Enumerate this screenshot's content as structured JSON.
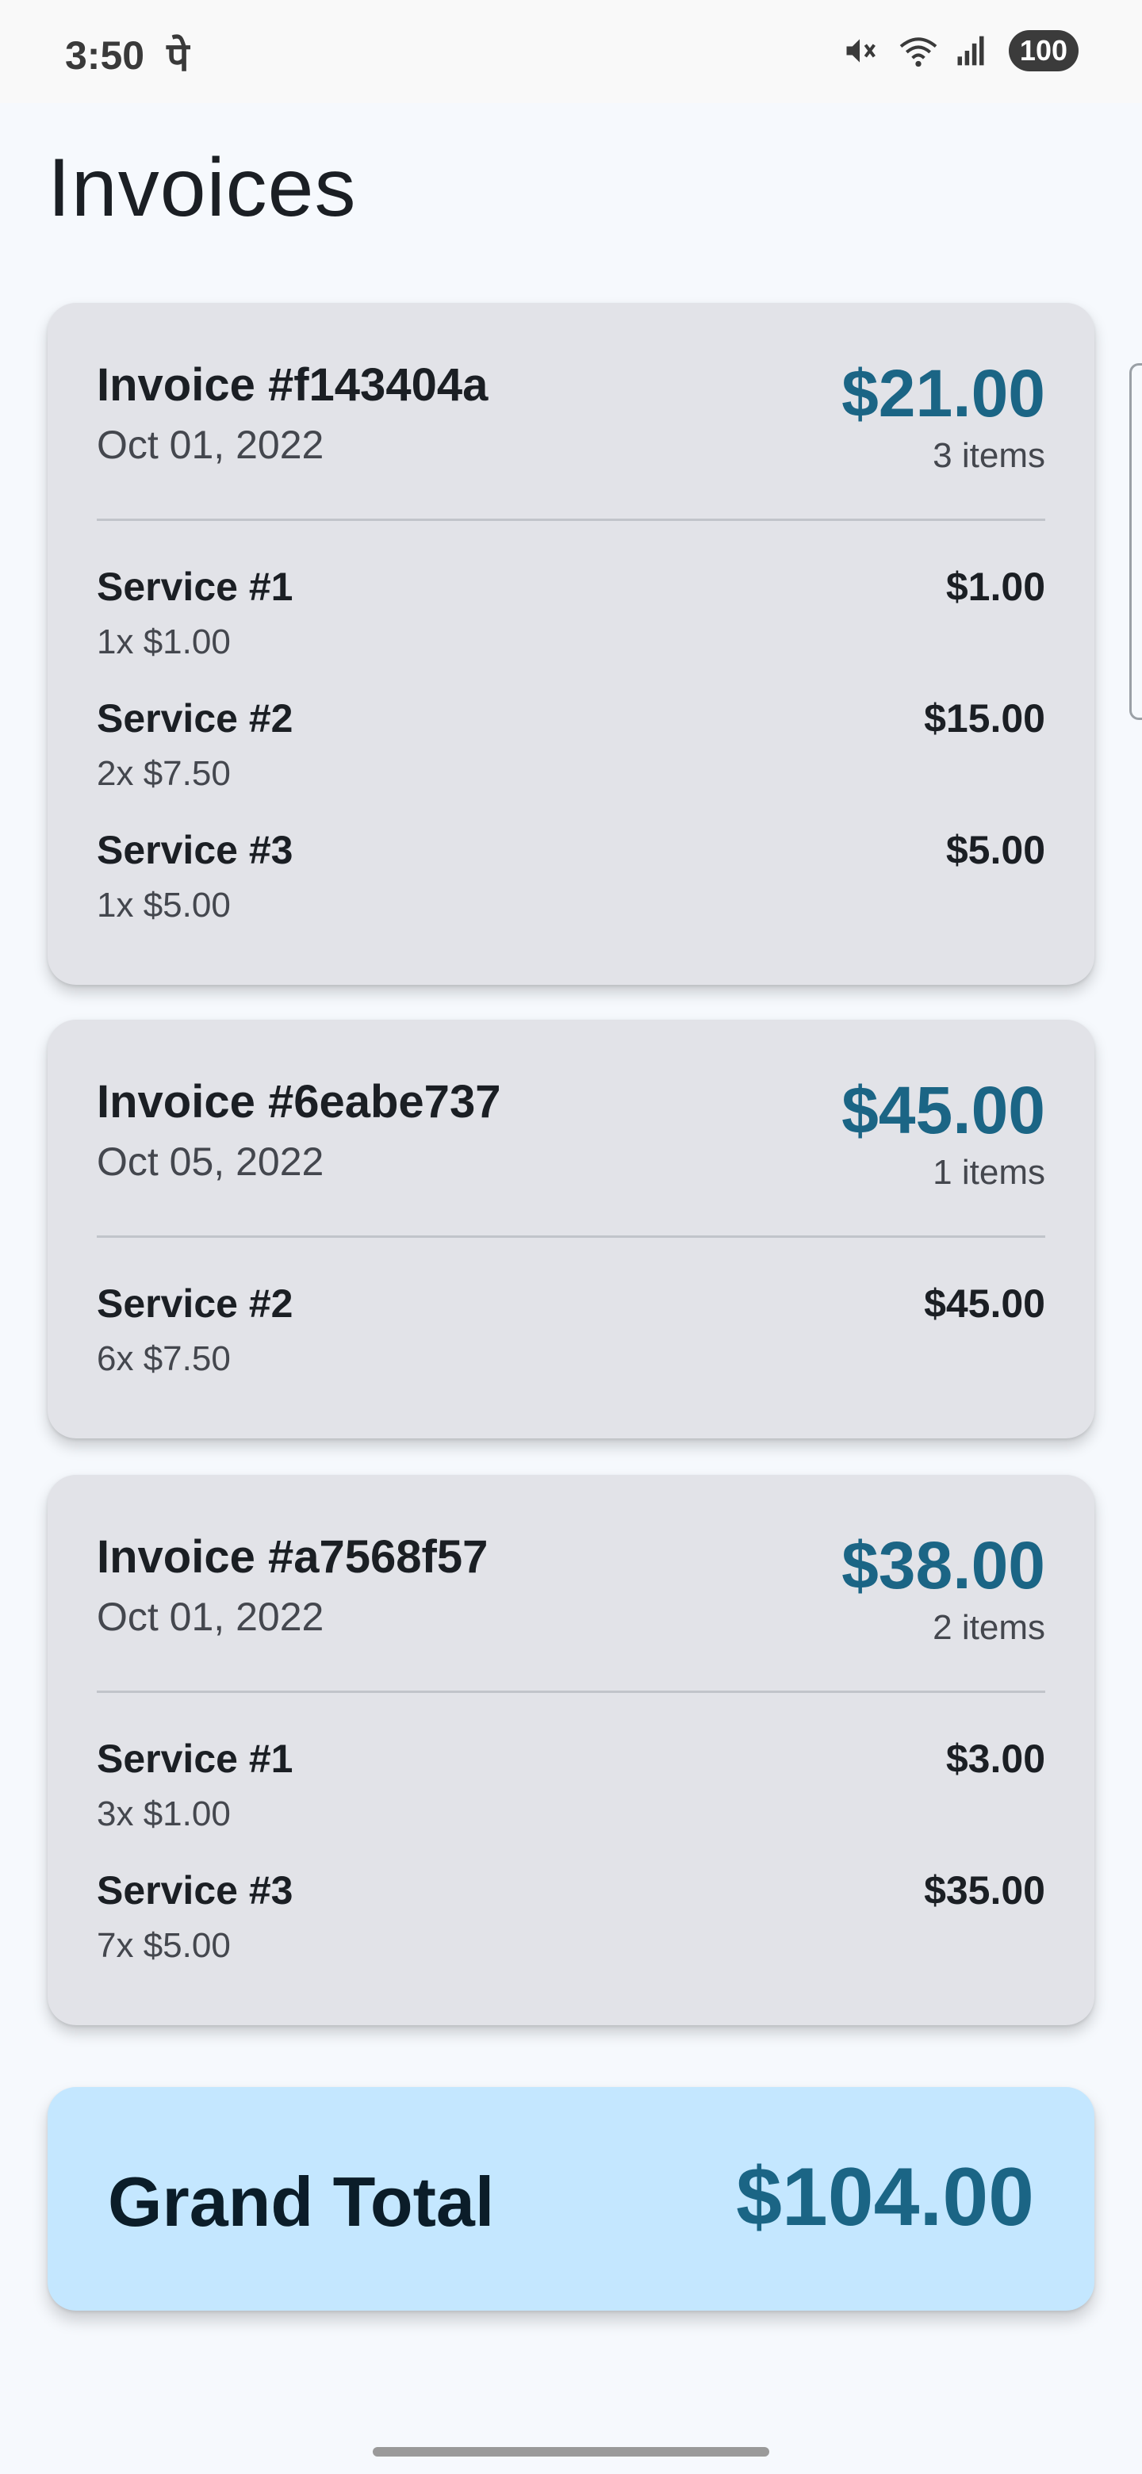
{
  "status_bar": {
    "time": "3:50",
    "notification_glyph": "पे",
    "battery": "100",
    "icons": [
      "mute-icon",
      "wifi-icon",
      "signal-icon"
    ]
  },
  "page": {
    "title": "Invoices"
  },
  "invoices": [
    {
      "number": "Invoice #f143404a",
      "date": "Oct 01, 2022",
      "total": "$21.00",
      "count": "3 items",
      "items": [
        {
          "name": "Service #1",
          "qty": "1x $1.00",
          "amount": "$1.00"
        },
        {
          "name": "Service #2",
          "qty": "2x $7.50",
          "amount": "$15.00"
        },
        {
          "name": "Service #3",
          "qty": "1x $5.00",
          "amount": "$5.00"
        }
      ]
    },
    {
      "number": "Invoice #6eabe737",
      "date": "Oct 05, 2022",
      "total": "$45.00",
      "count": "1 items",
      "items": [
        {
          "name": "Service #2",
          "qty": "6x $7.50",
          "amount": "$45.00"
        }
      ]
    },
    {
      "number": "Invoice #a7568f57",
      "date": "Oct 01, 2022",
      "total": "$38.00",
      "count": "2 items",
      "items": [
        {
          "name": "Service #1",
          "qty": "3x $1.00",
          "amount": "$3.00"
        },
        {
          "name": "Service #3",
          "qty": "7x $5.00",
          "amount": "$35.00"
        }
      ]
    }
  ],
  "grand_total": {
    "label": "Grand Total",
    "value": "$104.00"
  },
  "colors": {
    "accent": "#1b6585",
    "card": "#e2e3e8",
    "grand_total_bg": "#c4e7ff",
    "background": "#f6f9fd"
  }
}
